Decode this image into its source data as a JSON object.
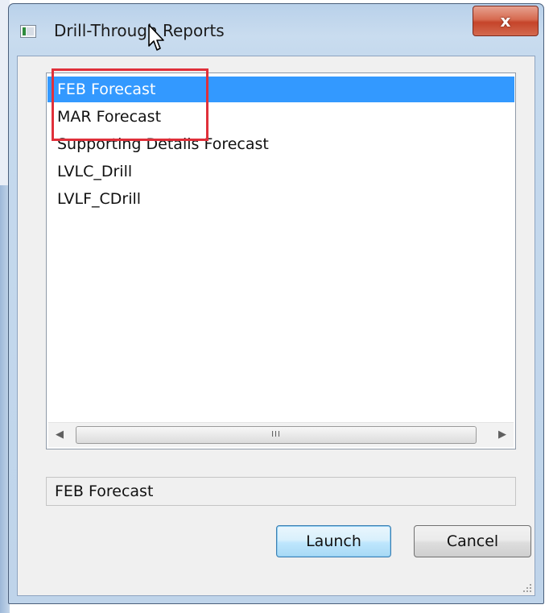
{
  "window": {
    "title": "Drill-Through Reports",
    "close_label": "x"
  },
  "report_list": {
    "items": [
      {
        "label": "FEB Forecast",
        "selected": true
      },
      {
        "label": "MAR Forecast",
        "selected": false
      },
      {
        "label": "Supporting Details Forecast",
        "selected": false
      },
      {
        "label": "LVLC_Drill",
        "selected": false
      },
      {
        "label": "LVLF_CDrill",
        "selected": false
      }
    ]
  },
  "scrollbar": {
    "left_arrow": "◀",
    "right_arrow": "▶",
    "thumb_grip": "III"
  },
  "status_field": {
    "value": "FEB Forecast"
  },
  "buttons": {
    "launch_label": "Launch",
    "cancel_label": "Cancel"
  },
  "colors": {
    "selection": "#3399ff",
    "annotation_box": "#e0303a",
    "close_button": "#c5442a"
  }
}
